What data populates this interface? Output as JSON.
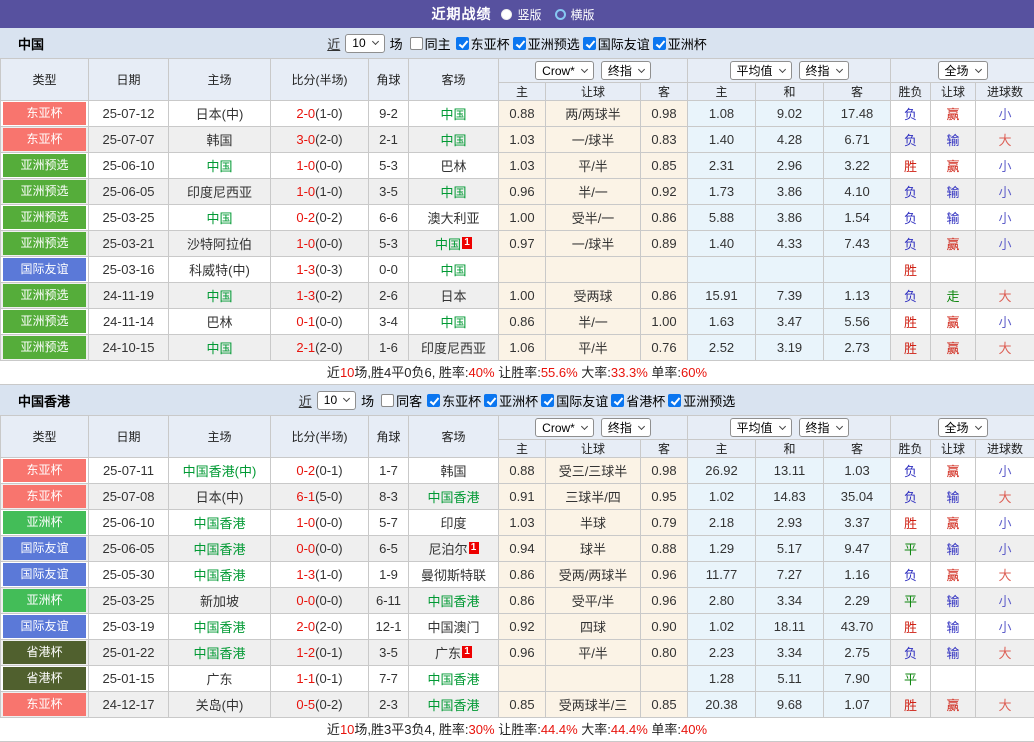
{
  "title_bar": {
    "title": "近期战绩",
    "options": [
      {
        "label": "竖版",
        "selected": true
      },
      {
        "label": "横版",
        "selected": false
      }
    ]
  },
  "table_header": {
    "main_cols": [
      "类型",
      "日期",
      "主场",
      "比分(半场)",
      "角球",
      "客场"
    ],
    "odds_selects": [
      [
        "Crow*",
        "终指"
      ],
      [
        "平均值",
        "终指"
      ],
      [
        "全场"
      ]
    ],
    "sub_cols": [
      "主",
      "让球",
      "客",
      "主",
      "和",
      "客",
      "胜负",
      "让球",
      "进球数"
    ]
  },
  "colors": {
    "topbar": "#57519f",
    "team_green": "#009933",
    "score_red": "#e8130c",
    "checkbox_blue": "#0b76f0",
    "type_badges": {
      "东亚杯": "#f8756e",
      "亚洲预选": "#55ad3a",
      "国际友谊": "#5b79d8",
      "亚洲杯": "#43bd58",
      "省港杯": "#50602e"
    },
    "result": {
      "red": "#cf2013",
      "blue": "#2f2fc0",
      "green": "#0e860e",
      "lred": "#dd5f55",
      "lblue": "#5f5fca"
    }
  },
  "sections": [
    {
      "team": "中国",
      "filter": {
        "near": "近",
        "count": "10",
        "games": "场",
        "same": "同主",
        "same_checked": false,
        "competitions": [
          "东亚杯",
          "亚洲预选",
          "国际友谊",
          "亚洲杯"
        ]
      },
      "rows": [
        {
          "type": "东亚杯",
          "date": "25-07-12",
          "home": "日本(中)",
          "home_green": false,
          "home_badge": "",
          "score": "2-0",
          "half": "(1-0)",
          "corner": "9-2",
          "away": "中国",
          "away_green": true,
          "away_badge": "",
          "odds": [
            "0.88",
            "两/两球半",
            "0.98",
            "1.08",
            "9.02",
            "17.48"
          ],
          "results": [
            [
              "负",
              "blue"
            ],
            [
              "赢",
              "red"
            ],
            [
              "小",
              "lblue"
            ]
          ]
        },
        {
          "type": "东亚杯",
          "date": "25-07-07",
          "home": "韩国",
          "home_green": false,
          "home_badge": "",
          "score": "3-0",
          "half": "(2-0)",
          "corner": "2-1",
          "away": "中国",
          "away_green": true,
          "away_badge": "",
          "odds": [
            "1.03",
            "一/球半",
            "0.83",
            "1.40",
            "4.28",
            "6.71"
          ],
          "results": [
            [
              "负",
              "blue"
            ],
            [
              "输",
              "blue"
            ],
            [
              "大",
              "lred"
            ]
          ]
        },
        {
          "type": "亚洲预选",
          "date": "25-06-10",
          "home": "中国",
          "home_green": true,
          "home_badge": "",
          "score": "1-0",
          "half": "(0-0)",
          "corner": "5-3",
          "away": "巴林",
          "away_green": false,
          "away_badge": "",
          "odds": [
            "1.03",
            "平/半",
            "0.85",
            "2.31",
            "2.96",
            "3.22"
          ],
          "results": [
            [
              "胜",
              "red"
            ],
            [
              "赢",
              "red"
            ],
            [
              "小",
              "lblue"
            ]
          ]
        },
        {
          "type": "亚洲预选",
          "date": "25-06-05",
          "home": "印度尼西亚",
          "home_green": false,
          "home_badge": "",
          "score": "1-0",
          "half": "(1-0)",
          "corner": "3-5",
          "away": "中国",
          "away_green": true,
          "away_badge": "",
          "odds": [
            "0.96",
            "半/一",
            "0.92",
            "1.73",
            "3.86",
            "4.10"
          ],
          "results": [
            [
              "负",
              "blue"
            ],
            [
              "输",
              "blue"
            ],
            [
              "小",
              "lblue"
            ]
          ]
        },
        {
          "type": "亚洲预选",
          "date": "25-03-25",
          "home": "中国",
          "home_green": true,
          "home_badge": "",
          "score": "0-2",
          "half": "(0-2)",
          "corner": "6-6",
          "away": "澳大利亚",
          "away_green": false,
          "away_badge": "",
          "odds": [
            "1.00",
            "受半/一",
            "0.86",
            "5.88",
            "3.86",
            "1.54"
          ],
          "results": [
            [
              "负",
              "blue"
            ],
            [
              "输",
              "blue"
            ],
            [
              "小",
              "lblue"
            ]
          ]
        },
        {
          "type": "亚洲预选",
          "date": "25-03-21",
          "home": "沙特阿拉伯",
          "home_green": false,
          "home_badge": "",
          "score": "1-0",
          "half": "(0-0)",
          "corner": "5-3",
          "away": "中国",
          "away_green": true,
          "away_badge": "1",
          "odds": [
            "0.97",
            "一/球半",
            "0.89",
            "1.40",
            "4.33",
            "7.43"
          ],
          "results": [
            [
              "负",
              "blue"
            ],
            [
              "赢",
              "red"
            ],
            [
              "小",
              "lblue"
            ]
          ]
        },
        {
          "type": "国际友谊",
          "date": "25-03-16",
          "home": "科威特(中)",
          "home_green": false,
          "home_badge": "",
          "score": "1-3",
          "half": "(0-3)",
          "corner": "0-0",
          "away": "中国",
          "away_green": true,
          "away_badge": "",
          "odds": [
            "",
            "",
            "",
            "",
            "",
            ""
          ],
          "results": [
            [
              "胜",
              "red"
            ],
            [
              "",
              ""
            ],
            [
              "",
              ""
            ]
          ]
        },
        {
          "type": "亚洲预选",
          "date": "24-11-19",
          "home": "中国",
          "home_green": true,
          "home_badge": "",
          "score": "1-3",
          "half": "(0-2)",
          "corner": "2-6",
          "away": "日本",
          "away_green": false,
          "away_badge": "",
          "odds": [
            "1.00",
            "受两球",
            "0.86",
            "15.91",
            "7.39",
            "1.13"
          ],
          "results": [
            [
              "负",
              "blue"
            ],
            [
              "走",
              "green"
            ],
            [
              "大",
              "lred"
            ]
          ]
        },
        {
          "type": "亚洲预选",
          "date": "24-11-14",
          "home": "巴林",
          "home_green": false,
          "home_badge": "",
          "score": "0-1",
          "half": "(0-0)",
          "corner": "3-4",
          "away": "中国",
          "away_green": true,
          "away_badge": "",
          "odds": [
            "0.86",
            "半/一",
            "1.00",
            "1.63",
            "3.47",
            "5.56"
          ],
          "results": [
            [
              "胜",
              "red"
            ],
            [
              "赢",
              "red"
            ],
            [
              "小",
              "lblue"
            ]
          ]
        },
        {
          "type": "亚洲预选",
          "date": "24-10-15",
          "home": "中国",
          "home_green": true,
          "home_badge": "",
          "score": "2-1",
          "half": "(2-0)",
          "corner": "1-6",
          "away": "印度尼西亚",
          "away_green": false,
          "away_badge": "",
          "odds": [
            "1.06",
            "平/半",
            "0.76",
            "2.52",
            "3.19",
            "2.73"
          ],
          "results": [
            [
              "胜",
              "red"
            ],
            [
              "赢",
              "red"
            ],
            [
              "大",
              "lred"
            ]
          ]
        }
      ],
      "summary": [
        [
          "近",
          0
        ],
        [
          "10",
          1
        ],
        [
          "场,胜4平0负6, 胜率:",
          0
        ],
        [
          "40%",
          1
        ],
        [
          " 让胜率:",
          0
        ],
        [
          "55.6%",
          1
        ],
        [
          " 大率:",
          0
        ],
        [
          "33.3%",
          1
        ],
        [
          " 单率:",
          0
        ],
        [
          "60%",
          1
        ]
      ]
    },
    {
      "team": "中国香港",
      "filter": {
        "near": "近",
        "count": "10",
        "games": "场",
        "same": "同客",
        "same_checked": false,
        "competitions": [
          "东亚杯",
          "亚洲杯",
          "国际友谊",
          "省港杯",
          "亚洲预选"
        ]
      },
      "rows": [
        {
          "type": "东亚杯",
          "date": "25-07-11",
          "home": "中国香港(中)",
          "home_green": true,
          "home_badge": "",
          "score": "0-2",
          "half": "(0-1)",
          "corner": "1-7",
          "away": "韩国",
          "away_green": false,
          "away_badge": "",
          "odds": [
            "0.88",
            "受三/三球半",
            "0.98",
            "26.92",
            "13.11",
            "1.03"
          ],
          "results": [
            [
              "负",
              "blue"
            ],
            [
              "赢",
              "red"
            ],
            [
              "小",
              "lblue"
            ]
          ]
        },
        {
          "type": "东亚杯",
          "date": "25-07-08",
          "home": "日本(中)",
          "home_green": false,
          "home_badge": "",
          "score": "6-1",
          "half": "(5-0)",
          "corner": "8-3",
          "away": "中国香港",
          "away_green": true,
          "away_badge": "",
          "odds": [
            "0.91",
            "三球半/四",
            "0.95",
            "1.02",
            "14.83",
            "35.04"
          ],
          "results": [
            [
              "负",
              "blue"
            ],
            [
              "输",
              "blue"
            ],
            [
              "大",
              "lred"
            ]
          ]
        },
        {
          "type": "亚洲杯",
          "date": "25-06-10",
          "home": "中国香港",
          "home_green": true,
          "home_badge": "",
          "score": "1-0",
          "half": "(0-0)",
          "corner": "5-7",
          "away": "印度",
          "away_green": false,
          "away_badge": "",
          "odds": [
            "1.03",
            "半球",
            "0.79",
            "2.18",
            "2.93",
            "3.37"
          ],
          "results": [
            [
              "胜",
              "red"
            ],
            [
              "赢",
              "red"
            ],
            [
              "小",
              "lblue"
            ]
          ]
        },
        {
          "type": "国际友谊",
          "date": "25-06-05",
          "home": "中国香港",
          "home_green": true,
          "home_badge": "",
          "score": "0-0",
          "half": "(0-0)",
          "corner": "6-5",
          "away": "尼泊尔",
          "away_green": false,
          "away_badge": "1",
          "odds": [
            "0.94",
            "球半",
            "0.88",
            "1.29",
            "5.17",
            "9.47"
          ],
          "results": [
            [
              "平",
              "green"
            ],
            [
              "输",
              "blue"
            ],
            [
              "小",
              "lblue"
            ]
          ]
        },
        {
          "type": "国际友谊",
          "date": "25-05-30",
          "home": "中国香港",
          "home_green": true,
          "home_badge": "",
          "score": "1-3",
          "half": "(1-0)",
          "corner": "1-9",
          "away": "曼彻斯特联",
          "away_green": false,
          "away_badge": "",
          "odds": [
            "0.86",
            "受两/两球半",
            "0.96",
            "11.77",
            "7.27",
            "1.16"
          ],
          "results": [
            [
              "负",
              "blue"
            ],
            [
              "赢",
              "red"
            ],
            [
              "大",
              "lred"
            ]
          ]
        },
        {
          "type": "亚洲杯",
          "date": "25-03-25",
          "home": "新加坡",
          "home_green": false,
          "home_badge": "",
          "score": "0-0",
          "half": "(0-0)",
          "corner": "6-11",
          "away": "中国香港",
          "away_green": true,
          "away_badge": "",
          "odds": [
            "0.86",
            "受平/半",
            "0.96",
            "2.80",
            "3.34",
            "2.29"
          ],
          "results": [
            [
              "平",
              "green"
            ],
            [
              "输",
              "blue"
            ],
            [
              "小",
              "lblue"
            ]
          ]
        },
        {
          "type": "国际友谊",
          "date": "25-03-19",
          "home": "中国香港",
          "home_green": true,
          "home_badge": "",
          "score": "2-0",
          "half": "(2-0)",
          "corner": "12-1",
          "away": "中国澳门",
          "away_green": false,
          "away_badge": "",
          "odds": [
            "0.92",
            "四球",
            "0.90",
            "1.02",
            "18.11",
            "43.70"
          ],
          "results": [
            [
              "胜",
              "red"
            ],
            [
              "输",
              "blue"
            ],
            [
              "小",
              "lblue"
            ]
          ]
        },
        {
          "type": "省港杯",
          "date": "25-01-22",
          "home": "中国香港",
          "home_green": true,
          "home_badge": "",
          "score": "1-2",
          "half": "(0-1)",
          "corner": "3-5",
          "away": "广东",
          "away_green": false,
          "away_badge": "1",
          "odds": [
            "0.96",
            "平/半",
            "0.80",
            "2.23",
            "3.34",
            "2.75"
          ],
          "results": [
            [
              "负",
              "blue"
            ],
            [
              "输",
              "blue"
            ],
            [
              "大",
              "lred"
            ]
          ]
        },
        {
          "type": "省港杯",
          "date": "25-01-15",
          "home": "广东",
          "home_green": false,
          "home_badge": "",
          "score": "1-1",
          "half": "(0-1)",
          "corner": "7-7",
          "away": "中国香港",
          "away_green": true,
          "away_badge": "",
          "odds": [
            "",
            "",
            "",
            "1.28",
            "5.11",
            "7.90"
          ],
          "results": [
            [
              "平",
              "green"
            ],
            [
              "",
              ""
            ],
            [
              "",
              ""
            ]
          ]
        },
        {
          "type": "东亚杯",
          "date": "24-12-17",
          "home": "关岛(中)",
          "home_green": false,
          "home_badge": "",
          "score": "0-5",
          "half": "(0-2)",
          "corner": "2-3",
          "away": "中国香港",
          "away_green": true,
          "away_badge": "",
          "odds": [
            "0.85",
            "受两球半/三",
            "0.85",
            "20.38",
            "9.68",
            "1.07"
          ],
          "results": [
            [
              "胜",
              "red"
            ],
            [
              "赢",
              "red"
            ],
            [
              "大",
              "lred"
            ]
          ]
        }
      ],
      "summary": [
        [
          "近",
          0
        ],
        [
          "10",
          1
        ],
        [
          "场,胜3平3负4, 胜率:",
          0
        ],
        [
          "30%",
          1
        ],
        [
          " 让胜率:",
          0
        ],
        [
          "44.4%",
          1
        ],
        [
          " 大率:",
          0
        ],
        [
          "44.4%",
          1
        ],
        [
          " 单率:",
          0
        ],
        [
          "40%",
          1
        ]
      ]
    }
  ]
}
